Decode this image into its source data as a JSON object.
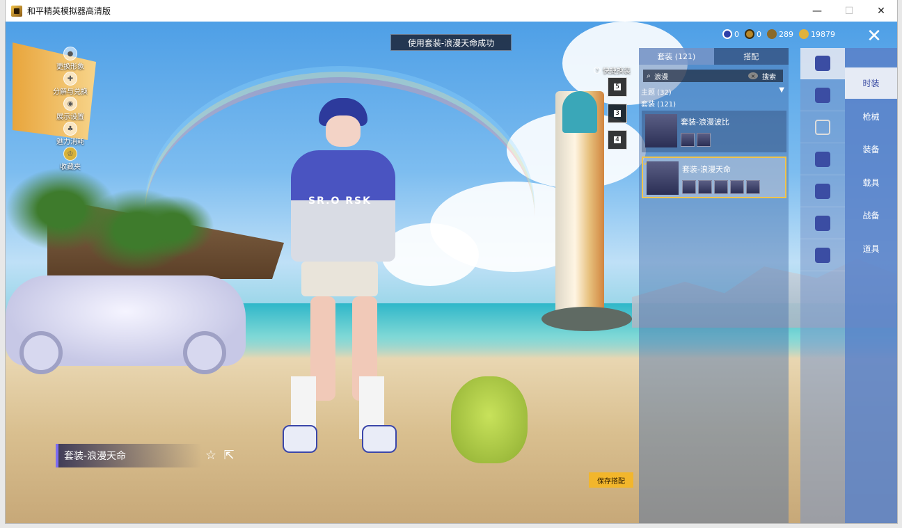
{
  "window": {
    "title": "和平精英模拟器高清版",
    "minimize": "—",
    "maximize": "☐",
    "close": "✕"
  },
  "toast": "使用套装-浪漫天命成功",
  "left_menu": [
    {
      "label": "更换形象",
      "icon": "person-icon"
    },
    {
      "label": "分解与兑换",
      "icon": "puzzle-icon"
    },
    {
      "label": "展示设置",
      "icon": "eye-icon"
    },
    {
      "label": "魅力消耗",
      "icon": "charm-icon"
    },
    {
      "label": "收藏夹",
      "icon": "crown-icon"
    }
  ],
  "presets": {
    "title": "快捷换装",
    "help": "?",
    "slots": [
      "5",
      "3",
      "4"
    ]
  },
  "currencies": [
    {
      "value": "0",
      "color": "#2d3fa8"
    },
    {
      "value": "0",
      "color": "#b8882a"
    },
    {
      "value": "289",
      "color": "#8a6a2a"
    },
    {
      "value": "19879",
      "color": "#e0b23c"
    }
  ],
  "close_button": "✕",
  "panel": {
    "tabs": [
      {
        "label": "套装 (121)",
        "active": true
      },
      {
        "label": "搭配",
        "active": false
      }
    ],
    "search": {
      "value": "浪漫",
      "clear": "×",
      "button": "搜索"
    },
    "filter_theme": "主题 (32)",
    "filter_arrow": "▼",
    "filter_suit": "套装 (121)",
    "outfits": [
      {
        "name": "套装-浪漫波比",
        "selected": false,
        "items": 2
      },
      {
        "name": "套装-浪漫天命",
        "selected": true,
        "items": 5
      }
    ],
    "check": "✓"
  },
  "categories": [
    "outfit-icon",
    "hat-icon",
    "glasses-icon",
    "weapon-skin-icon",
    "vehicle-skin-icon",
    "character-icon",
    "emote-icon"
  ],
  "nav": [
    {
      "label": "时装",
      "active": true
    },
    {
      "label": "枪械",
      "active": false
    },
    {
      "label": "装备",
      "active": false
    },
    {
      "label": "载具",
      "active": false
    },
    {
      "label": "战备",
      "active": false
    },
    {
      "label": "道具",
      "active": false
    }
  ],
  "name_tag": "套装-浪漫天命",
  "star": "☆",
  "share": "⇱",
  "save_button": "保存搭配",
  "character": {
    "jacket_text": "SR.O RSK"
  }
}
